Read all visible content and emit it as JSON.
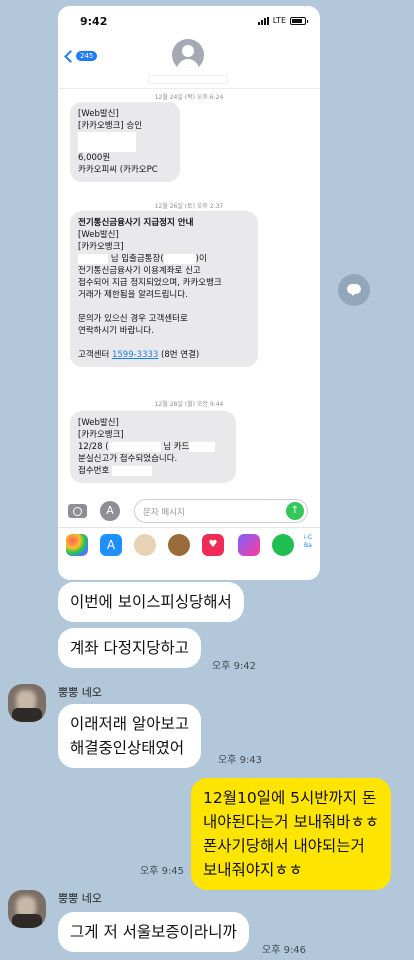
{
  "screenshot": {
    "status_bar": {
      "time": "9:42",
      "carrier": "LTE"
    },
    "back_badge": "245",
    "messages": [
      {
        "timestamp": "12월 24일 (목) 오후 6:24"
      },
      {
        "lines": [
          "[Web발신]",
          "[카카오뱅크] 승인",
          "6,000원",
          "카카오피씨 (카카오PC"
        ]
      },
      {
        "timestamp": "12월 26일 (토) 오후 2:37"
      },
      {
        "title": "전기통신금융사기 지급정지 안내",
        "lines": [
          "[Web발신]",
          "[카카오뱅크]",
          "님 입출금통장(",
          ")이",
          "전기통신금융사기 이용계좌로 신고",
          "접수되어 지급 정지되었으며, 카카오뱅크",
          "거래가 제한됨을 알려드립니다.",
          "문의가 있으신 경우 고객센터로",
          "연락하시기 바랍니다."
        ],
        "call_prefix": "고객센터",
        "phone": "1599-3333",
        "call_suffix": "(8번 연결)"
      },
      {
        "timestamp": "12월 28일 (월) 오전 9:44"
      },
      {
        "lines": [
          "[Web발신]",
          "[카카오뱅크]",
          "12/28 (",
          "님 카드",
          "분실신고가 접수되었습니다.",
          "접수번호"
        ]
      }
    ],
    "composer": {
      "placeholder": "문자 메시지"
    },
    "app_more_label": "i-C Ba"
  },
  "chat": [
    {
      "text": "이번에 보이스피싱당해서"
    },
    {
      "text": "계좌 다정지당하고",
      "time": "오후 9:42"
    },
    {
      "sender": "뿡뿡 네오",
      "lines": [
        "이래저래 알아보고",
        "해결중인상태였어"
      ],
      "time": "오후 9:43"
    },
    {
      "lines": [
        "12월10일에 5시반까지 돈",
        "내야된다는거 보내줘바ㅎㅎ",
        "폰사기당해서 내야되는거",
        "보내줘야지ㅎㅎ"
      ],
      "time": "오후 9:45"
    },
    {
      "sender": "뿡뿡 네오",
      "text": "그게 저 서울보증이라니까",
      "time": "오후 9:46"
    }
  ]
}
